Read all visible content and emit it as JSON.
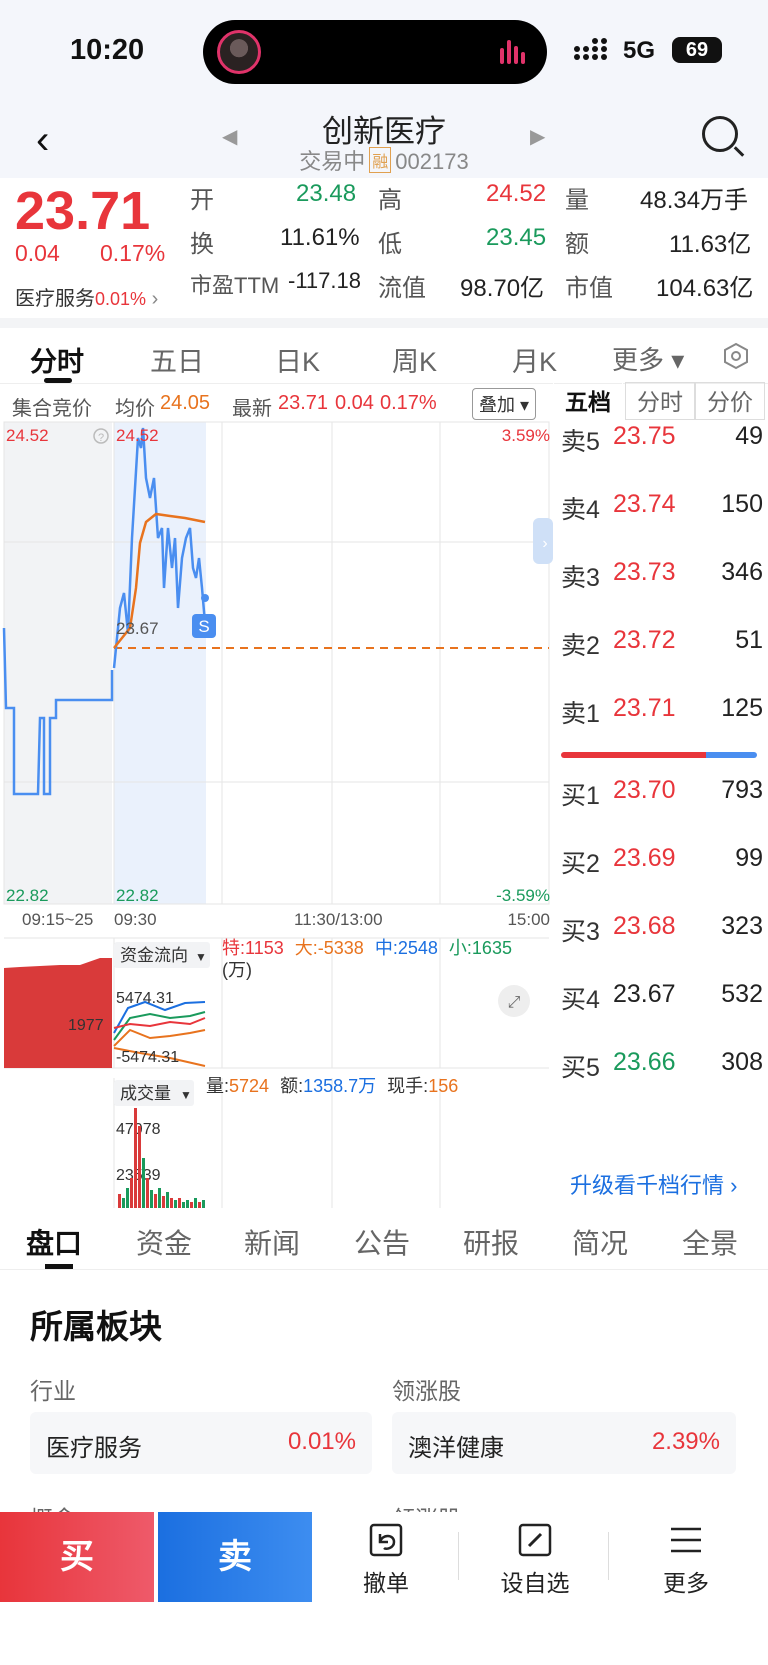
{
  "status_bar": {
    "time": "10:20",
    "network": "5G",
    "battery": "69"
  },
  "header": {
    "title": "创新医疗",
    "status": "交易中",
    "margin_badge": "融",
    "code": "002173"
  },
  "quote": {
    "price": "23.71",
    "change": "0.04",
    "change_pct": "0.17%",
    "sector_name": "医疗服务",
    "sector_pct": "0.01%",
    "open_label": "开",
    "open": "23.48",
    "high_label": "高",
    "high": "24.52",
    "volume_label": "量",
    "volume": "48.34万手",
    "turnover_label": "换",
    "turnover": "11.61%",
    "low_label": "低",
    "low": "23.45",
    "amount_label": "额",
    "amount": "11.63亿",
    "pe_label": "市盈TTM",
    "pe": "-117.18",
    "float_label": "流值",
    "float_cap": "98.70亿",
    "mcap_label": "市值",
    "mcap": "104.63亿"
  },
  "chart_tabs": [
    "分时",
    "五日",
    "日K",
    "周K",
    "月K",
    "更多 ▾"
  ],
  "chart_info": {
    "auction": "集合竞价",
    "avg_label": "均价",
    "avg": "24.05",
    "latest_label": "最新",
    "latest": "23.71",
    "latest_chg": "0.04",
    "latest_pct": "0.17%",
    "overlay": "叠加"
  },
  "chart_axes": {
    "left_top": "24.52",
    "left_bottom": "22.82",
    "mid_top": "24.52",
    "mid_bottom": "22.82",
    "mid_ref": "23.67",
    "right_top": "3.59%",
    "right_bottom": "-3.59%",
    "t0": "09:15~25",
    "t1": "09:30",
    "t2": "11:30/13:00",
    "t3": "15:00",
    "s_marker": "S"
  },
  "fund_flow": {
    "label": "资金流向",
    "unit": "(万)",
    "te_label": "特:",
    "te": "1153",
    "da_label": "大:",
    "da": "-5338",
    "zhong_label": "中:",
    "zhong": "2548",
    "xiao_label": "小:",
    "xiao": "1635",
    "top": "5474.31",
    "bottom": "-5474.31",
    "mid": "1977"
  },
  "volume_panel": {
    "label": "成交量",
    "vol_label": "量:",
    "vol": "5724",
    "amt_label": "额:",
    "amt": "1358.7万",
    "cur_label": "现手:",
    "cur": "156",
    "max": "47078",
    "mid": "23539"
  },
  "chart_data": {
    "type": "line",
    "title": "",
    "y_range": [
      22.82,
      24.52
    ],
    "prev_close": 23.67,
    "series": [
      {
        "values": [
          23.75,
          23.78,
          23.55,
          24.52,
          24.1,
          24.25,
          23.9,
          24.05,
          23.8,
          23.71
        ]
      },
      {
        "values": [
          23.75,
          23.9,
          24.1,
          24.12,
          24.1,
          24.08,
          24.06,
          24.05
        ]
      }
    ]
  },
  "order_book": {
    "tabs": [
      "五档",
      "分时",
      "分价"
    ],
    "asks": [
      {
        "label": "卖5",
        "price": "23.75",
        "vol": "49"
      },
      {
        "label": "卖4",
        "price": "23.74",
        "vol": "150"
      },
      {
        "label": "卖3",
        "price": "23.73",
        "vol": "346"
      },
      {
        "label": "卖2",
        "price": "23.72",
        "vol": "51"
      },
      {
        "label": "卖1",
        "price": "23.71",
        "vol": "125"
      }
    ],
    "bids": [
      {
        "label": "买1",
        "price": "23.70",
        "vol": "793"
      },
      {
        "label": "买2",
        "price": "23.69",
        "vol": "99"
      },
      {
        "label": "买3",
        "price": "23.68",
        "vol": "323"
      },
      {
        "label": "买4",
        "price": "23.67",
        "vol": "532"
      },
      {
        "label": "买5",
        "price": "23.66",
        "vol": "308"
      }
    ],
    "upgrade": "升级看千档行情 ›"
  },
  "bottom_tabs": [
    "盘口",
    "资金",
    "新闻",
    "公告",
    "研报",
    "简况",
    "全景"
  ],
  "sector_section": {
    "title": "所属板块",
    "industry_label": "行业",
    "industry": "医疗服务",
    "industry_pct": "0.01%",
    "leader_label": "领涨股",
    "leader": "澳洋健康",
    "leader_pct": "2.39%",
    "concept_label": "概念",
    "leader2_label": "领涨股"
  },
  "actions": {
    "buy": "买",
    "sell": "卖",
    "cancel": "撤单",
    "watch": "设自选",
    "more": "更多"
  },
  "colors": {
    "up": "#e8353b",
    "down": "#1a9a5c",
    "price_line": "#4a8ef0",
    "avg_line": "#e8731e"
  }
}
